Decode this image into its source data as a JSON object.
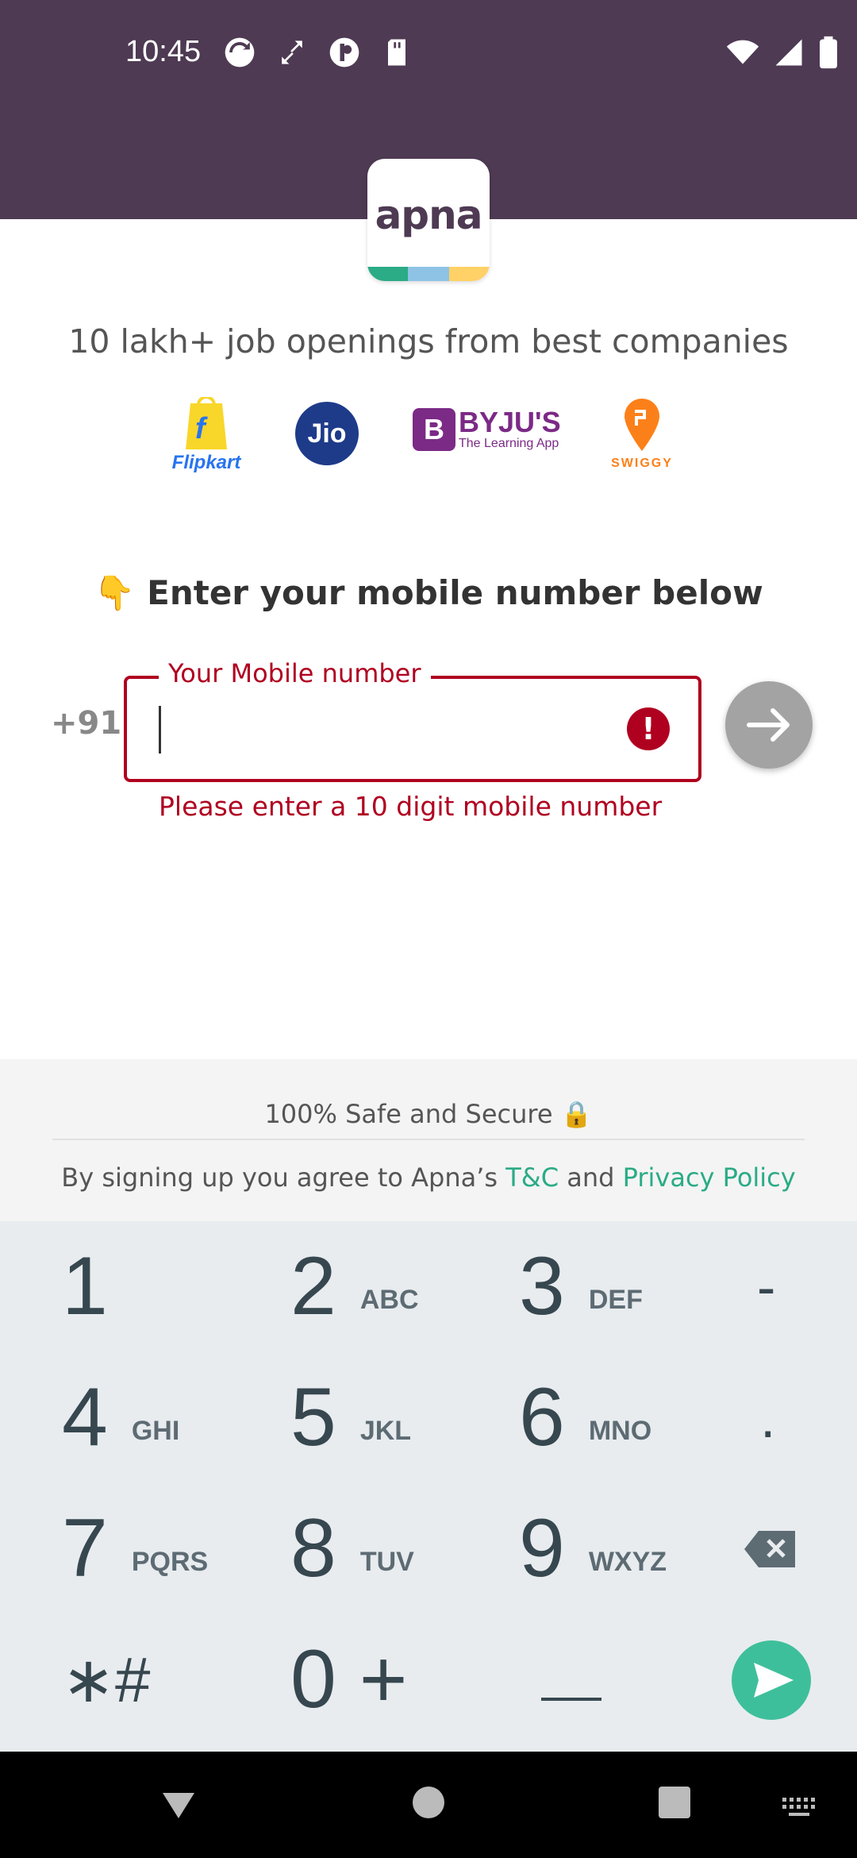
{
  "status_bar": {
    "time": "10:45",
    "left_icons": [
      "sync-icon",
      "data-transfer-icon",
      "app-notification-icon",
      "sd-card-icon"
    ],
    "right_icons": [
      "wifi-icon",
      "signal-icon",
      "battery-icon"
    ]
  },
  "logo": {
    "text": "apna",
    "stripe_colors": [
      "#2bab86",
      "#8ec3e6",
      "#ffd166"
    ]
  },
  "tagline": "10 lakh+ job openings from best companies",
  "brands": [
    {
      "name": "Flipkart",
      "icon": "flipkart-logo"
    },
    {
      "name": "Jio",
      "icon": "jio-logo"
    },
    {
      "name": "BYJU'S",
      "subtitle": "The Learning App",
      "icon": "byjus-logo"
    },
    {
      "name": "SWIGGY",
      "icon": "swiggy-logo"
    }
  ],
  "headline": {
    "emoji": "👇",
    "text": "Enter your mobile number below"
  },
  "phone": {
    "country_code": "+91",
    "label": "Your Mobile number",
    "value": "",
    "error": "Please enter a 10 digit mobile number"
  },
  "footer": {
    "safe_text": "100% Safe and Secure 🔒",
    "terms_prefix": "By signing up you agree to Apna’s",
    "terms_link": "T&C",
    "and": "and",
    "privacy_link": "Privacy Policy"
  },
  "keypad": {
    "keys": [
      {
        "digit": "1",
        "letters": ""
      },
      {
        "digit": "2",
        "letters": "ABC"
      },
      {
        "digit": "3",
        "letters": "DEF"
      },
      {
        "digit": "-",
        "letters": ""
      },
      {
        "digit": "4",
        "letters": "GHI"
      },
      {
        "digit": "5",
        "letters": "JKL"
      },
      {
        "digit": "6",
        "letters": "MNO"
      },
      {
        "digit": ".",
        "letters": ""
      },
      {
        "digit": "7",
        "letters": "PQRS"
      },
      {
        "digit": "8",
        "letters": "TUV"
      },
      {
        "digit": "9",
        "letters": "WXYZ"
      },
      {
        "digit": "⌫",
        "letters": ""
      },
      {
        "digit": "∗#",
        "letters": ""
      },
      {
        "digit": "0 +",
        "letters": ""
      },
      {
        "digit": "␣",
        "letters": ""
      },
      {
        "digit": "➤",
        "letters": ""
      }
    ]
  },
  "colors": {
    "header": "#4e3a53",
    "error": "#b00020",
    "accent_green": "#2bab86",
    "keypad_bg": "#e8ecef"
  }
}
